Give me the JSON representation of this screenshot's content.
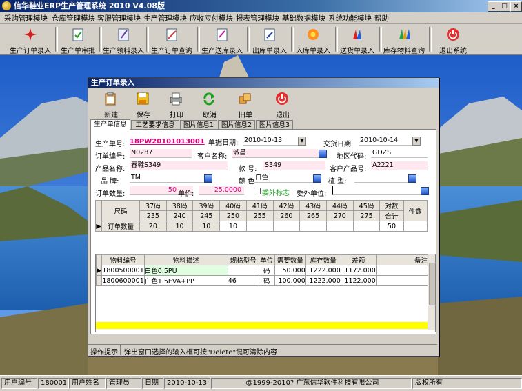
{
  "app": {
    "title": "信华鞋业ERP生产管理系统   2010 V4.08版"
  },
  "menu": [
    "采购管理模块",
    "仓库管理模块",
    "客服管理模块",
    "生产管理模块",
    "应收应付模块",
    "报表管理模块",
    "基础数据模块",
    "系统功能模块",
    "帮助"
  ],
  "toolbar": [
    "生产订单录入",
    "生产单审批",
    "生产领料录入",
    "生产订单查询",
    "生产送库录入",
    "出库单录入",
    "入库单录入",
    "送货单录入",
    "库存物料查询",
    "退出系统"
  ],
  "child": {
    "title": "生产订单录入",
    "buttons": [
      "新建",
      "保存",
      "打印",
      "取消",
      "旧单",
      "退出"
    ],
    "tabs": [
      "生产单信息",
      "工艺要求信息",
      "图片信息1",
      "图片信息2",
      "图片信息3"
    ],
    "form": {
      "prod_no_label": "生产单号:",
      "prod_no": "18PW20101013001",
      "bill_date_label": "单据日期:",
      "bill_date": "2010-10-13",
      "delivery_label": "交货日期:",
      "delivery": "2010-10-14",
      "order_no_label": "订单编号:",
      "order_no": "N0287",
      "customer_label": "客户名称:",
      "customer": "诚昌",
      "region_label": "地区代码:",
      "region": "GDZS",
      "product_label": "产品名称:",
      "product": "春鞋S349",
      "style_label": "款  号:",
      "style": "S349",
      "cust_prod_label": "客户产品号:",
      "cust_prod": "A2221",
      "brand_label": "品  牌:",
      "brand": "TM",
      "color_label": "颜  色:",
      "color": "白色",
      "last_label": "楦  型:",
      "last": "",
      "qty_label": "订单数量:",
      "qty": "50",
      "price_label": "单价:",
      "price": "25.0000",
      "outsource_label": "委外标志",
      "outsource_unit_label": "委外单位:",
      "outsource_unit": ""
    },
    "size_grid": {
      "size_label": "尺码",
      "headers": [
        "37码",
        "38码",
        "39码",
        "40码",
        "41码",
        "42码",
        "43码",
        "44码",
        "45码",
        "对数"
      ],
      "sizes": [
        "235",
        "240",
        "245",
        "250",
        "255",
        "260",
        "265",
        "270",
        "275",
        "合计"
      ],
      "extra_header": "件数",
      "row_label": "订单数量",
      "row_values": [
        "20",
        "10",
        "10",
        "10",
        "",
        "",
        "",
        "",
        "",
        "50"
      ]
    },
    "material_grid": {
      "headers": [
        "物料编号",
        "物料描述",
        "规格型号",
        "单位",
        "需要数量",
        "库存数量",
        "差额",
        "备注"
      ],
      "rows": [
        [
          "1800500001",
          "白色0.5PU",
          "",
          "码",
          "50.000",
          "1222.000",
          "1172.000",
          ""
        ],
        [
          "1800600001",
          "白色1.5EVA+PP",
          "46",
          "码",
          "100.000",
          "1222.000",
          "1122.000",
          ""
        ]
      ]
    },
    "hint_label": "操作提示",
    "hint": "弹出窗口选择的输入框可按\"Delete\"键可清除内容"
  },
  "status": {
    "user_no_label": "用户编号",
    "user_no": "180001",
    "user_name_label": "用户姓名",
    "user_name": "管理员",
    "date_label": "日期",
    "date": "2010-10-13",
    "copyright": "@1999-2010?  广东信华软件科技有限公司",
    "rights": "版权所有"
  },
  "colors": {
    "title_bar": "#0a246a",
    "accent_pink": "#e0007f",
    "grid_total": "#ffff00"
  }
}
